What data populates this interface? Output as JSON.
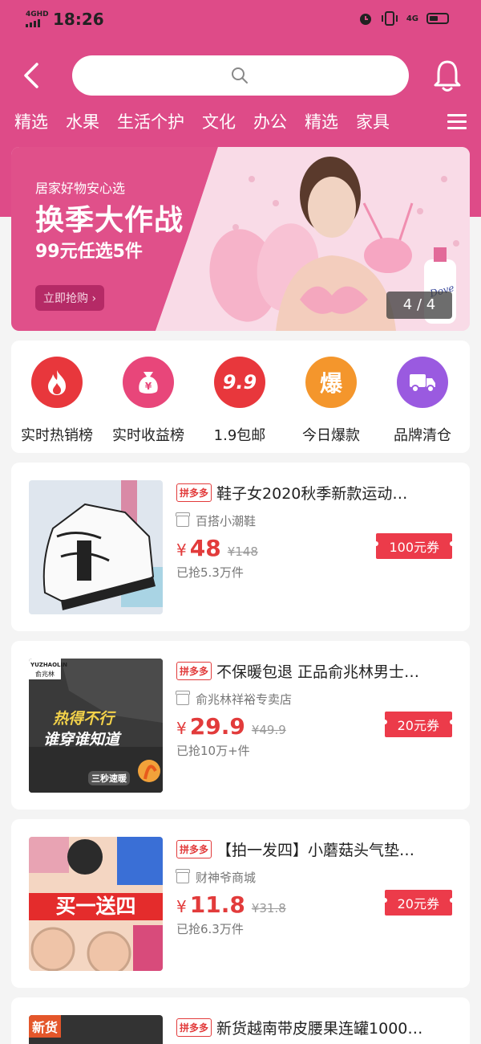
{
  "status": {
    "network": "4GHD",
    "time": "18:26",
    "mobile": "4G"
  },
  "tabs": [
    "精选",
    "水果",
    "生活个护",
    "文化",
    "办公",
    "精选",
    "家具"
  ],
  "banner": {
    "subtitle": "居家好物安心选",
    "title": "换季大作战",
    "promo": "99元任选5件",
    "button": "立即抢购",
    "counter": "4 / 4",
    "brand": "Dove"
  },
  "categories": [
    {
      "label": "实时热销榜",
      "icon": "fire-icon",
      "color": "#e8373c"
    },
    {
      "label": "实时收益榜",
      "icon": "money-bag-icon",
      "color": "#e8467a"
    },
    {
      "label": "1.9包邮",
      "icon": "nine-nine-icon",
      "color": "#e8373c",
      "glyph": "9.9"
    },
    {
      "label": "今日爆款",
      "icon": "explode-icon",
      "color": "#f4962c",
      "glyph": "爆"
    },
    {
      "label": "品牌清仓",
      "icon": "truck-icon",
      "color": "#9a5ae0"
    }
  ],
  "products": [
    {
      "tag": "拼多多",
      "title": "鞋子女2020秋季新款运动…",
      "shop": "百搭小潮鞋",
      "currency": "¥",
      "price": "48",
      "orig": "¥148",
      "sold": "已抢5.3万件",
      "coupon": "100元券"
    },
    {
      "tag": "拼多多",
      "title": "不保暖包退 正品俞兆林男士…",
      "shop": "俞兆林祥裕专卖店",
      "currency": "¥",
      "price": "29.9",
      "orig": "¥49.9",
      "sold": "已抢10万+件",
      "coupon": "20元券",
      "img_text": [
        "YUZHAOLIN",
        "俞兆林",
        "热得不行",
        "谁穿谁知道",
        "三秒速暖"
      ]
    },
    {
      "tag": "拼多多",
      "title": "【拍一发四】小蘑菇头气垫…",
      "shop": "财神爷商城",
      "currency": "¥",
      "price": "11.8",
      "orig": "¥31.8",
      "sold": "已抢6.3万件",
      "coupon": "20元券",
      "img_text": [
        "买一送四"
      ]
    },
    {
      "tag": "拼多多",
      "title": "新货越南带皮腰果连罐1000…",
      "img_text": [
        "新货"
      ]
    }
  ]
}
